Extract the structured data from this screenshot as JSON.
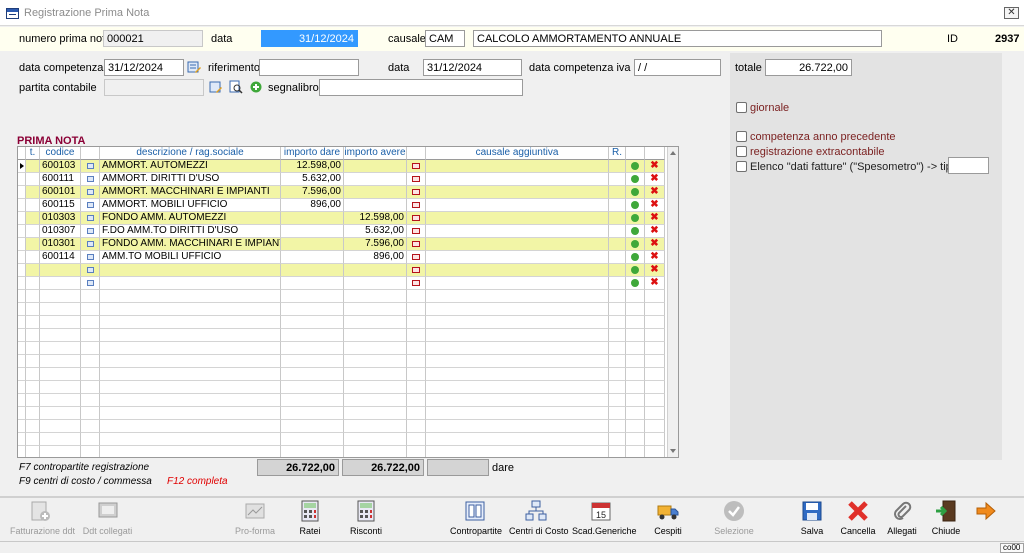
{
  "window": {
    "title": "Registrazione Prima Nota"
  },
  "header": {
    "numero_label": "numero prima nota",
    "numero": "000021",
    "data_label": "data",
    "data": "31/12/2024",
    "causale_label": "causale",
    "causale_code": "CAM",
    "causale_desc": "CALCOLO AMMORTAMENTO ANNUALE",
    "id_label": "ID",
    "id_value": "2937"
  },
  "form": {
    "data_competenza_label": "data competenza",
    "data_competenza": "31/12/2024",
    "riferimento_label": "riferimento",
    "riferimento": "",
    "data2_label": "data",
    "data2": "31/12/2024",
    "data_comp_iva_label": "data competenza iva",
    "data_comp_iva": " / /",
    "totale_label": "totale",
    "totale": "26.722,00",
    "partita_label": "partita contabile",
    "partita": "",
    "segnalibro_label": "segnalibro",
    "segnalibro": ""
  },
  "options": {
    "giornale": "giornale",
    "competenza": "competenza anno precedente",
    "extracontabile": "registrazione extracontabile",
    "elenco": "Elenco \"dati fatture\" (\"Spesometro\") -> tipo doc.",
    "tipo_doc": ""
  },
  "grid": {
    "section_title": "PRIMA NOTA",
    "columns": [
      "t.",
      "codice",
      "",
      "descrizione / rag.sociale",
      "importo dare",
      "importo avere",
      "",
      "causale aggiuntiva",
      "R.",
      "",
      ""
    ],
    "rows": [
      {
        "codice": "600103",
        "desc": "AMMORT. AUTOMEZZI",
        "dare": "12.598,00",
        "avere": "",
        "hl": true,
        "current": true
      },
      {
        "codice": "600111",
        "desc": "AMMORT. DIRITTI D'USO",
        "dare": "5.632,00",
        "avere": "",
        "hl": false
      },
      {
        "codice": "600101",
        "desc": "AMMORT. MACCHINARI E IMPIANTI",
        "dare": "7.596,00",
        "avere": "",
        "hl": true
      },
      {
        "codice": "600115",
        "desc": "AMMORT. MOBILI UFFICIO",
        "dare": "896,00",
        "avere": "",
        "hl": false
      },
      {
        "codice": "010303",
        "desc": "FONDO AMM. AUTOMEZZI",
        "dare": "",
        "avere": "12.598,00",
        "hl": true
      },
      {
        "codice": "010307",
        "desc": "F.DO AMM.TO DIRITTI D'USO",
        "dare": "",
        "avere": "5.632,00",
        "hl": false
      },
      {
        "codice": "010301",
        "desc": "FONDO AMM. MACCHINARI E IMPIANTI",
        "dare": "",
        "avere": "7.596,00",
        "hl": true
      },
      {
        "codice": "600114",
        "desc": "AMM.TO MOBILI UFFICIO",
        "dare": "",
        "avere": "896,00",
        "hl": false
      },
      {
        "codice": "",
        "desc": "",
        "dare": "",
        "avere": "",
        "hl": true
      },
      {
        "codice": "",
        "desc": "",
        "dare": "",
        "avere": "",
        "hl": false
      }
    ],
    "empty_rows": 13
  },
  "totals": {
    "f7": "F7 contropartite registrazione",
    "dare": "26.722,00",
    "avere": "26.722,00",
    "diff": "",
    "label": "dare"
  },
  "footnotes": {
    "f9": "F9 centri di costo / commessa",
    "f12": "F12 completa"
  },
  "toolbar": [
    {
      "label": "Fatturazione ddt",
      "disabled": true
    },
    {
      "label": "Ddt collegati",
      "disabled": true
    },
    {
      "label": "Pro-forma",
      "disabled": true
    },
    {
      "label": "Ratei",
      "disabled": false
    },
    {
      "label": "Risconti",
      "disabled": false
    },
    {
      "label": "Contropartite",
      "disabled": false
    },
    {
      "label": "Centri di Costo",
      "disabled": false
    },
    {
      "label": "Scad.Generiche",
      "disabled": false
    },
    {
      "label": "Cespiti",
      "disabled": false
    },
    {
      "label": "Selezione",
      "disabled": true
    },
    {
      "label": "Salva",
      "disabled": false
    },
    {
      "label": "Cancella",
      "disabled": false
    },
    {
      "label": "Allegati",
      "disabled": false
    },
    {
      "label": "Chiude",
      "disabled": false
    }
  ],
  "calendar_day": "15",
  "status": {
    "right": "co00"
  }
}
